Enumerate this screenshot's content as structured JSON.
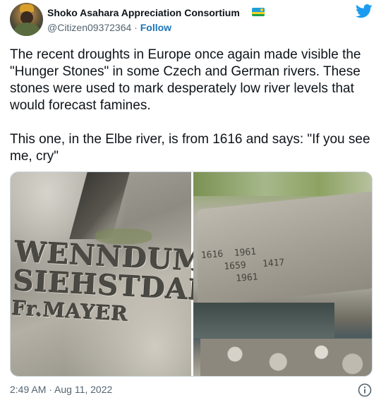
{
  "author": {
    "display_name": "Shoko Asahara Appreciation Consortium",
    "handle": "@Citizen09372364",
    "separator": " · ",
    "follow_label": "Follow",
    "flag_icon": "rwanda-flag-icon",
    "avatar_icon": "avatar-image"
  },
  "brand": {
    "icon": "twitter-bird-icon",
    "color": "#1d9bf0"
  },
  "tweet": {
    "text": "The recent droughts in Europe once again made visible the \"Hunger Stones\" in some Czech and German rivers. These stones were used to mark desperately low river levels that would forecast famines.\n\nThis one, in the Elbe river, is from 1616 and says: \"If you see me, cry\"",
    "timestamp": "2:49 AM · Aug 11, 2022"
  },
  "media": {
    "left_photo": {
      "line1": "WENNDUM",
      "line2": "SIEHSTDANI",
      "line3": "Fr.MAYER"
    },
    "right_photo": {
      "inscriptions": "1616  1961\n    1659   1417\n      1961"
    }
  },
  "colors": {
    "text_primary": "#0f1419",
    "text_secondary": "#536471",
    "link": "#1b74b8"
  }
}
